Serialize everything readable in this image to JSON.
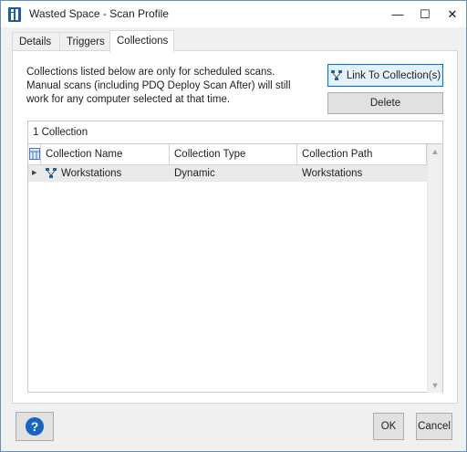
{
  "window": {
    "title": "Wasted Space - Scan Profile",
    "controls": {
      "minimize": "—",
      "maximize": "☐",
      "close": "✕"
    }
  },
  "tabs": [
    {
      "label": "Details",
      "active": false
    },
    {
      "label": "Triggers",
      "active": false
    },
    {
      "label": "Collections",
      "active": true
    }
  ],
  "collections_tab": {
    "info_text": "Collections listed below are only for scheduled scans. Manual scans (including PDQ Deploy Scan After) will still work for any computer selected at that time.",
    "link_button": "Link To Collection(s)",
    "delete_button": "Delete",
    "count_label": "1 Collection",
    "columns": [
      "Collection Name",
      "Collection Type",
      "Collection Path"
    ],
    "rows": [
      {
        "name": "Workstations",
        "type": "Dynamic",
        "path": "Workstations"
      }
    ]
  },
  "footer": {
    "help_button": "?",
    "ok_button": "OK",
    "cancel_button": "Cancel"
  },
  "colors": {
    "accent": "#0078d7",
    "app_icon": "#1f5e9e",
    "help_icon": "#1565c0"
  }
}
